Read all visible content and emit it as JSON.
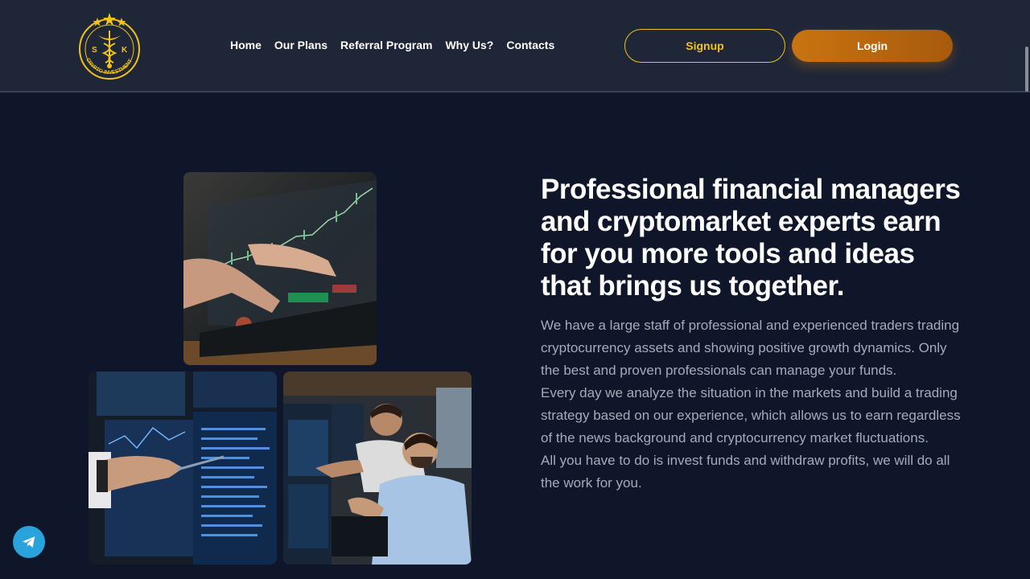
{
  "brand": {
    "logo_letters": [
      "S",
      "K"
    ],
    "logo_ring_text": "CRYPTO INVESTMENT",
    "accent_color": "#f0c419",
    "logo_icon": "caduceus-icon"
  },
  "nav": {
    "items": [
      {
        "label": "Home"
      },
      {
        "label": "Our Plans"
      },
      {
        "label": "Referral Program"
      },
      {
        "label": "Why Us?"
      },
      {
        "label": "Contacts"
      }
    ]
  },
  "auth": {
    "signup_label": "Signup",
    "login_label": "Login",
    "login_color": "#c97410"
  },
  "hero": {
    "headline": "Professional financial managers and cryptomarket experts earn for you more tools and ideas that brings us together.",
    "paragraphs": [
      "We have a large staff of professional and experienced traders trading cryptocurrency assets and showing positive growth dynamics. Only the best and proven professionals can manage your funds.",
      "Every day we analyze the situation in the markets and build a trading strategy based on our experience, which allows us to earn regardless of the news background and cryptocurrency market fluctuations.",
      "All you have to do is invest funds and withdraw profits, we will do all the work for you."
    ]
  },
  "images": [
    {
      "icon": "trading-laptop-image"
    },
    {
      "icon": "trading-monitors-image"
    },
    {
      "icon": "traders-team-image"
    }
  ],
  "floating": {
    "telegram_icon": "telegram-icon",
    "telegram_color": "#2aa3dd"
  }
}
